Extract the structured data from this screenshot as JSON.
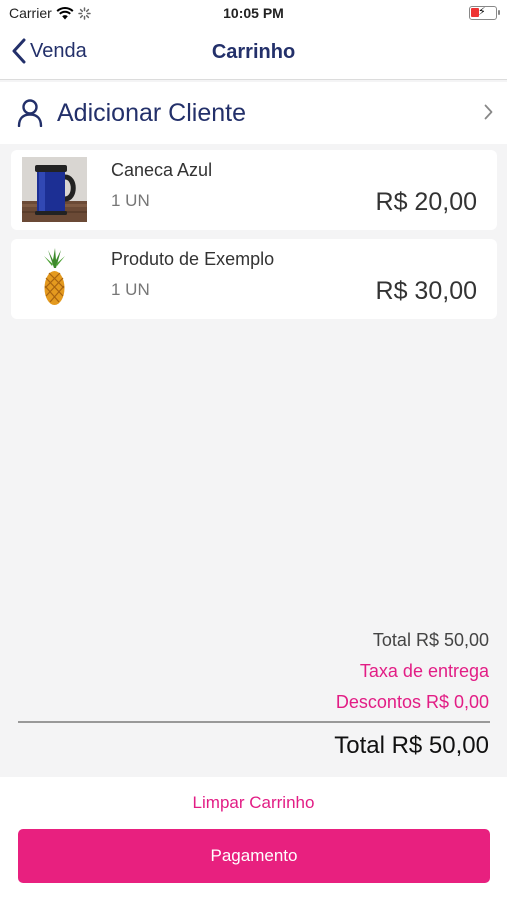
{
  "status_bar": {
    "carrier": "Carrier",
    "time": "10:05 PM"
  },
  "nav": {
    "back_label": "Venda",
    "title": "Carrinho"
  },
  "client": {
    "add_label": "Adicionar Cliente"
  },
  "products": [
    {
      "name": "Caneca Azul",
      "qty": "1 UN",
      "price": "R$ 20,00",
      "icon": "mug-image"
    },
    {
      "name": "Produto de Exemplo",
      "qty": "1 UN",
      "price": "R$ 30,00",
      "icon": "pineapple-image"
    }
  ],
  "summary": {
    "subtotal": "Total R$ 50,00",
    "delivery_label": "Taxa de entrega",
    "discount": "Descontos R$ 0,00",
    "grand_total": "Total R$ 50,00"
  },
  "footer": {
    "clear_label": "Limpar Carrinho",
    "pay_label": "Pagamento"
  },
  "colors": {
    "accent": "#e8207f",
    "primary": "#23306a",
    "background": "#f4f4f5"
  }
}
